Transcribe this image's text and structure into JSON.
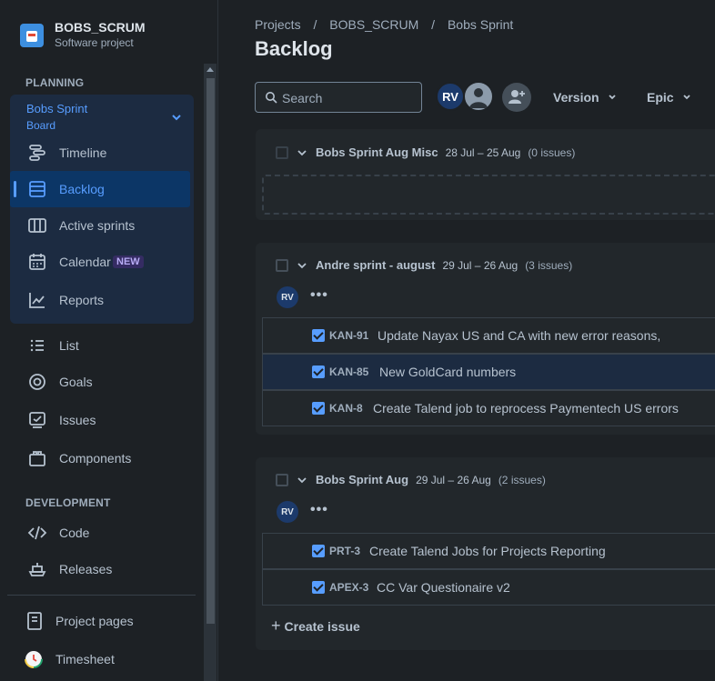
{
  "project": {
    "name": "BOBS_SCRUM",
    "type": "Software project"
  },
  "sidebar": {
    "planning_label": "PLANNING",
    "sprint": {
      "title": "Bobs Sprint",
      "subtitle": "Board"
    },
    "planning_items": [
      {
        "label": "Timeline",
        "icon": "timeline-icon"
      },
      {
        "label": "Backlog",
        "icon": "backlog-icon",
        "active": true
      },
      {
        "label": "Active sprints",
        "icon": "board-columns-icon"
      },
      {
        "label": "Calendar",
        "icon": "calendar-icon",
        "badge": "NEW"
      },
      {
        "label": "Reports",
        "icon": "reports-icon"
      }
    ],
    "other_items": [
      {
        "label": "List",
        "icon": "list-icon"
      },
      {
        "label": "Goals",
        "icon": "goals-icon"
      },
      {
        "label": "Issues",
        "icon": "issues-icon"
      },
      {
        "label": "Components",
        "icon": "components-icon"
      }
    ],
    "development_label": "DEVELOPMENT",
    "dev_items": [
      {
        "label": "Code",
        "icon": "code-icon"
      },
      {
        "label": "Releases",
        "icon": "releases-icon"
      }
    ],
    "footer_items": [
      {
        "label": "Project pages",
        "icon": "page-icon"
      },
      {
        "label": "Timesheet",
        "icon": "timesheet-icon"
      }
    ]
  },
  "breadcrumb": [
    "Projects",
    "/",
    "BOBS_SCRUM",
    "/",
    "Bobs Sprint"
  ],
  "page_title": "Backlog",
  "toolbar": {
    "search_placeholder": "Search",
    "avatar_initials": "RV",
    "version_label": "Version",
    "epic_label": "Epic"
  },
  "sprints": [
    {
      "name": "Bobs Sprint Aug Misc",
      "dates": "28 Jul – 25 Aug",
      "count": "(0 issues)",
      "issues": []
    },
    {
      "name": "Andre sprint - august",
      "dates": "29 Jul – 26 Aug",
      "count": "(3 issues)",
      "assignee": "RV",
      "issues": [
        {
          "key": "KAN-91",
          "summary": "Update Nayax US and CA with new error reasons,"
        },
        {
          "key": "KAN-85",
          "summary": "New GoldCard numbers",
          "selected": true
        },
        {
          "key": "KAN-8",
          "summary": "Create Talend job to reprocess Paymentech US errors"
        }
      ]
    },
    {
      "name": "Bobs Sprint Aug",
      "dates": "29 Jul – 26 Aug",
      "count": "(2 issues)",
      "assignee": "RV",
      "issues": [
        {
          "key": "PRT-3",
          "summary": "Create Talend Jobs for Projects Reporting"
        },
        {
          "key": "APEX-3",
          "summary": "CC Var Questionaire v2"
        }
      ]
    }
  ],
  "create_issue_label": "Create issue",
  "colors": {
    "accent": "#579dff",
    "background": "#1d2125",
    "panel": "#22272b"
  }
}
